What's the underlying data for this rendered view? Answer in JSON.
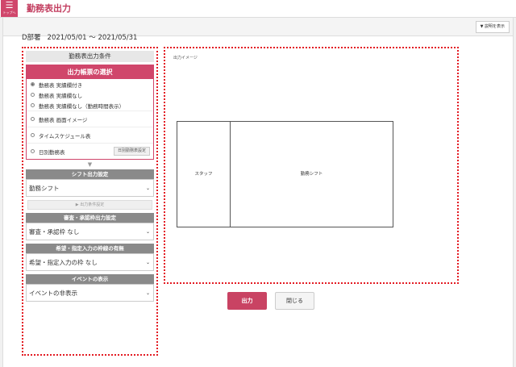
{
  "header": {
    "menu_icon": "☰",
    "menu_label": "トップへ",
    "title": "勤務表出力"
  },
  "infobar": {
    "help_label": "▼ 説明を表示"
  },
  "context": {
    "dept": "D部署",
    "period": "2021/05/01 ～ 2021/05/31"
  },
  "conditions": {
    "header": "勤務表出力条件",
    "form_select": {
      "title": "出力帳票の選択",
      "options": [
        {
          "label": "勤務表 実績欄付き",
          "selected": true
        },
        {
          "label": "勤務表 実績欄なし",
          "selected": false
        },
        {
          "label": "勤務表 実績欄なし（勤務時間表示）",
          "selected": false
        },
        {
          "label": "勤務表 画面イメージ",
          "selected": false
        },
        {
          "label": "タイムスケジュール表",
          "selected": false
        },
        {
          "label": "日別勤務表",
          "selected": false
        }
      ],
      "daily_settings_button": "日別勤務表設定"
    },
    "arrow": "▼",
    "shift": {
      "header": "シフト出力設定",
      "value": "勤務シフト",
      "cond_button": "▶ 出力条件設定"
    },
    "approval": {
      "header": "審査・承認枠出力設定",
      "value": "審査・承認枠 なし"
    },
    "request": {
      "header": "希望・指定入力の枠線の有無",
      "value": "希望・指定入力の枠 なし"
    },
    "event": {
      "header": "イベントの表示",
      "value": "イベントの非表示"
    },
    "chevron": "⌄"
  },
  "preview": {
    "label": "出力イメージ",
    "staff": "スタッフ",
    "shift": "勤務シフト"
  },
  "actions": {
    "output": "出力",
    "close": "閉じる"
  },
  "colors": {
    "accent": "#d0466b",
    "highlight": "#e31b23"
  }
}
